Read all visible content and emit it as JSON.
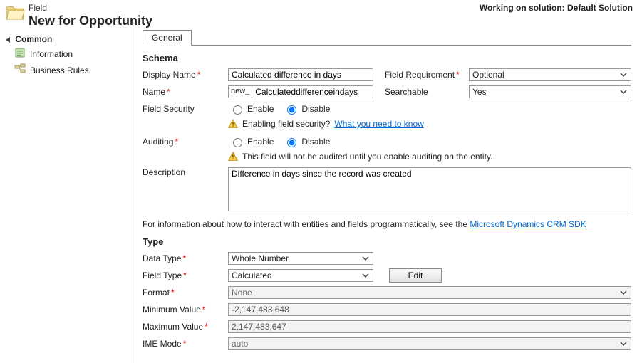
{
  "header": {
    "small": "Field",
    "title": "New for Opportunity",
    "solution": "Working on solution: Default Solution"
  },
  "sidebar": {
    "heading": "Common",
    "items": [
      {
        "label": "Information"
      },
      {
        "label": "Business Rules"
      }
    ]
  },
  "tabs": {
    "general": "General"
  },
  "schema": {
    "heading": "Schema",
    "display_name_label": "Display Name",
    "display_name_value": "Calculated difference in days",
    "field_requirement_label": "Field Requirement",
    "field_requirement_value": "Optional",
    "name_label": "Name",
    "name_prefix": "new_",
    "name_value": "Calculateddifferenceindays",
    "searchable_label": "Searchable",
    "searchable_value": "Yes",
    "field_security_label": "Field Security",
    "enable": "Enable",
    "disable": "Disable",
    "security_warn_text": "Enabling field security?",
    "security_warn_link": "What you need to know",
    "auditing_label": "Auditing",
    "auditing_warn": "This field will not be audited until you enable auditing on the entity.",
    "description_label": "Description",
    "description_value": "Difference in days since the record was created",
    "sdk_text": "For information about how to interact with entities and fields programmatically, see the ",
    "sdk_link": "Microsoft Dynamics CRM SDK"
  },
  "type": {
    "heading": "Type",
    "data_type_label": "Data Type",
    "data_type_value": "Whole Number",
    "field_type_label": "Field Type",
    "field_type_value": "Calculated",
    "edit_label": "Edit",
    "format_label": "Format",
    "format_value": "None",
    "min_label": "Minimum Value",
    "min_value": "-2,147,483,648",
    "max_label": "Maximum Value",
    "max_value": "2,147,483,647",
    "ime_label": "IME Mode",
    "ime_value": "auto"
  }
}
